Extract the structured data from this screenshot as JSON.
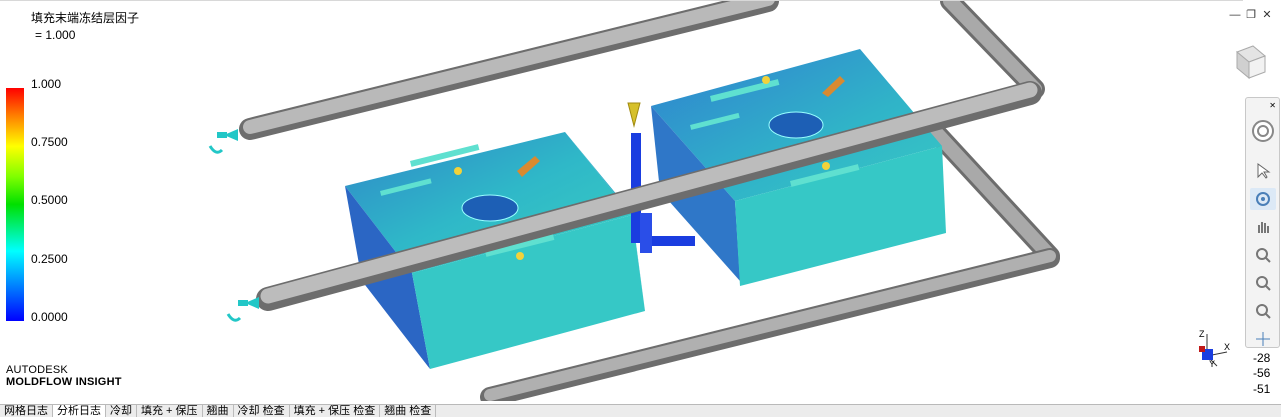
{
  "result": {
    "title": "填充末端冻结层因子",
    "subtitle": "= 1.000"
  },
  "legend": {
    "labels": [
      "1.000",
      "0.7500",
      "0.5000",
      "0.2500",
      "0.0000"
    ]
  },
  "brand": {
    "line1": "AUTODESK",
    "line2": "MOLDFLOW INSIGHT"
  },
  "axes_triad": {
    "z": "Z",
    "x": "X",
    "y": "Y"
  },
  "coordinates": [
    "-28",
    "-56",
    "-51"
  ],
  "tabs": [
    {
      "label": "网格日志",
      "active": false
    },
    {
      "label": "分析日志",
      "active": true
    },
    {
      "label": "冷却",
      "active": false
    },
    {
      "label": "填充 + 保压",
      "active": false
    },
    {
      "label": "翘曲",
      "active": false
    },
    {
      "label": "冷却 检查",
      "active": false
    },
    {
      "label": "填充 + 保压 检查",
      "active": false
    },
    {
      "label": "翘曲 检查",
      "active": false
    }
  ],
  "toolbar_icons": [
    "steering-wheel-icon",
    "select-icon",
    "orbit-icon",
    "pan-icon",
    "zoom-icon",
    "zoom-window-icon",
    "zoom-extents-icon",
    "center-icon"
  ],
  "colors": {
    "part": "#33c9c9",
    "part_top": "#2aa6c8",
    "runner": "#1a3de0",
    "pipe": "#a8a8a8",
    "active_tool": "#dce9f6"
  }
}
